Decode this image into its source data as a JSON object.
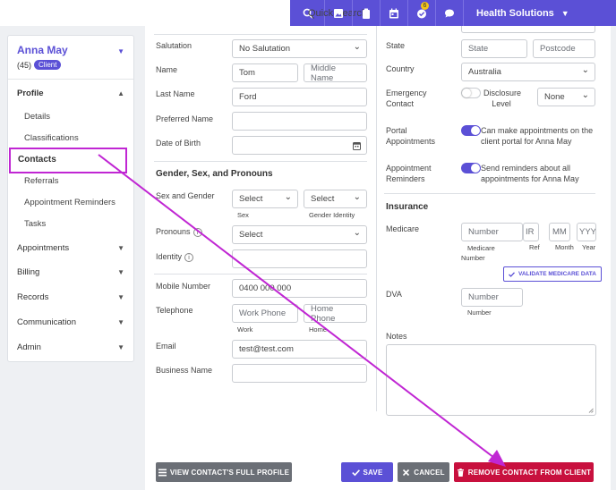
{
  "topbar": {
    "search_label": "Quick Search",
    "notification_count": "6",
    "org_name": "Health Solutions",
    "icons": [
      "image-icon",
      "clipboard-icon",
      "calendar-icon",
      "check-circle-icon",
      "chat-icon"
    ]
  },
  "sidebar": {
    "client_name": "Anna May",
    "client_id": "(45)",
    "client_badge": "Client",
    "profile_label": "Profile",
    "profile_items": [
      "Details",
      "Classifications",
      "Contacts",
      "Referrals",
      "Appointment Reminders",
      "Tasks"
    ],
    "sections": [
      "Appointments",
      "Billing",
      "Records",
      "Communication",
      "Admin"
    ]
  },
  "form": {
    "salutation_label": "Salutation",
    "salutation_value": "No Salutation",
    "name_label": "Name",
    "first_name": "Tom",
    "middle_name_placeholder": "Middle Name",
    "last_name_label": "Last Name",
    "last_name": "Ford",
    "preferred_name_label": "Preferred Name",
    "dob_label": "Date of Birth",
    "gsp_title": "Gender, Sex, and Pronouns",
    "sex_gender_label": "Sex and Gender",
    "select_placeholder": "Select",
    "sex_label": "Sex",
    "gender_identity_label": "Gender Identity",
    "pronouns_label": "Pronouns",
    "identity_label": "Identity",
    "mobile_label": "Mobile Number",
    "mobile_value": "0400 000 000",
    "telephone_label": "Telephone",
    "work_phone_placeholder": "Work Phone",
    "home_phone_placeholder": "Home Phone",
    "work_label": "Work",
    "home_label": "Home",
    "email_label": "Email",
    "email_value": "test@test.com",
    "business_name_label": "Business Name"
  },
  "right": {
    "state_label": "State",
    "state_placeholder": "State",
    "postcode_placeholder": "Postcode",
    "country_label": "Country",
    "country_value": "Australia",
    "emergency_label_1": "Emergency",
    "emergency_label_2": "Contact",
    "disclosure_1": "Disclosure",
    "disclosure_2": "Level",
    "disclosure_value": "None",
    "portal_label_1": "Portal",
    "portal_label_2": "Appointments",
    "portal_text_1": "Can make appointments on the",
    "portal_text_2": "client portal for Anna May",
    "reminders_label_1": "Appointment",
    "reminders_label_2": "Reminders",
    "reminders_text_1": "Send reminders about all",
    "reminders_text_2": "appointments for Anna May",
    "insurance_title": "Insurance",
    "medicare_label": "Medicare",
    "number_placeholder": "Number",
    "irn_placeholder": "IR",
    "mm_placeholder": "MM",
    "yyyy_placeholder": "YYYY",
    "medicare_number_1": "Medicare",
    "medicare_number_2": "Number",
    "ref_label": "Ref",
    "month_label": "Month",
    "year_label": "Year",
    "validate_label": "VALIDATE MEDICARE DATA",
    "dva_label": "DVA",
    "dva_number_label": "Number",
    "notes_label": "Notes"
  },
  "footer": {
    "view_profile": "VIEW CONTACT'S FULL PROFILE",
    "save": "SAVE",
    "cancel": "CANCEL",
    "remove": "REMOVE CONTACT FROM CLIENT"
  },
  "colors": {
    "brand": "#5b50d6",
    "danger": "#c8103e",
    "secondary": "#6b6f76",
    "annotation": "#c026d3"
  }
}
